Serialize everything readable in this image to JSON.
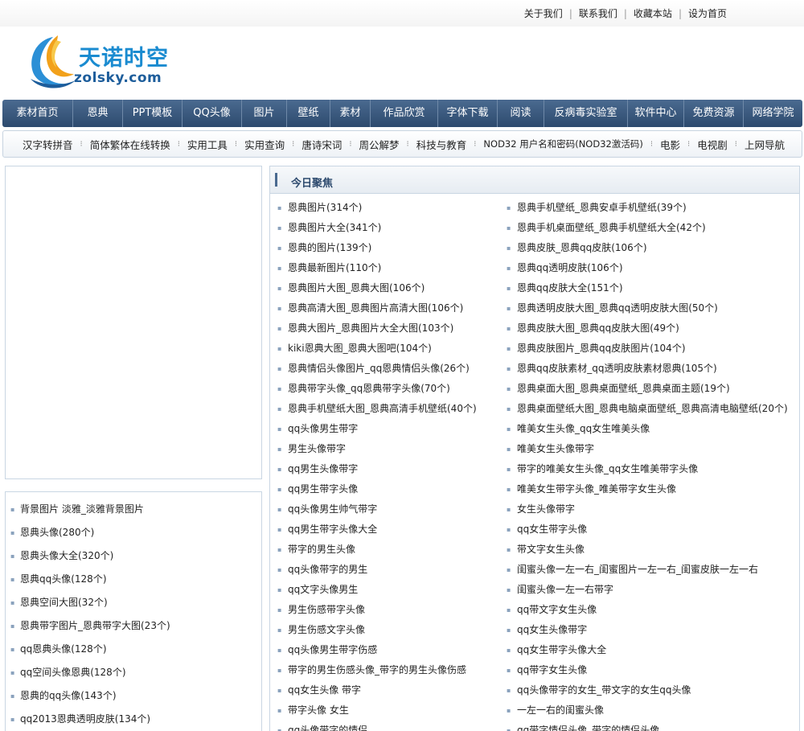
{
  "top_links": [
    "关于我们",
    "联系我们",
    "收藏本站",
    "设为首页"
  ],
  "logo": {
    "cn": "天诺时空",
    "en": "zolsky.com"
  },
  "main_nav": [
    "素材首页",
    "恩典",
    "PPT模板",
    "QQ头像",
    "图片",
    "壁纸",
    "素材",
    "作品欣赏",
    "字体下载",
    "阅读",
    "反病毒实验室",
    "软件中心",
    "免费资源",
    "网络学院"
  ],
  "sub_nav": [
    "汉字转拼音",
    "简体繁体在线转换",
    "实用工具",
    "实用查询",
    "唐诗宋词",
    "周公解梦",
    "科技与教育",
    "NOD32 用户名和密码(NOD32激活码)",
    "电影",
    "电视剧",
    "上网导航"
  ],
  "left_list": [
    "背景图片 淡雅_淡雅背景图片",
    "恩典头像(280个)",
    "恩典头像大全(320个)",
    "恩典qq头像(128个)",
    "恩典空间大图(32个)",
    "恩典带字图片_恩典带字大图(23个)",
    "qq恩典头像(128个)",
    "qq空间头像恩典(128个)",
    "恩典的qq头像(143个)",
    "qq2013恩典透明皮肤(134个)"
  ],
  "focus": {
    "title": "今日聚焦",
    "left": [
      "恩典图片(314个)",
      "恩典图片大全(341个)",
      "恩典的图片(139个)",
      "恩典最新图片(110个)",
      "恩典图片大图_恩典大图(106个)",
      "恩典高清大图_恩典图片高清大图(106个)",
      "恩典大图片_恩典图片大全大图(103个)",
      "kiki恩典大图_恩典大图吧(104个)",
      "恩典情侣头像图片_qq恩典情侣头像(26个)",
      "恩典带字头像_qq恩典带字头像(70个)",
      "恩典手机壁纸大图_恩典高清手机壁纸(40个)",
      "qq头像男生带字",
      "男生头像带字",
      "qq男生头像带字",
      "qq男生带字头像",
      "qq头像男生帅气带字",
      "qq男生带字头像大全",
      "带字的男生头像",
      "qq头像带字的男生",
      "qq文字头像男生",
      "男生伤感带字头像",
      "男生伤感文字头像",
      "qq头像男生带字伤感",
      "带字的男生伤感头像_带字的男生头像伤感",
      "qq女生头像 带字",
      "带字头像 女生",
      "qq头像带字的情侣"
    ],
    "right": [
      "恩典手机壁纸_恩典安卓手机壁纸(39个)",
      "恩典手机桌面壁纸_恩典手机壁纸大全(42个)",
      "恩典皮肤_恩典qq皮肤(106个)",
      "恩典qq透明皮肤(106个)",
      "恩典qq皮肤大全(151个)",
      "恩典透明皮肤大图_恩典qq透明皮肤大图(50个)",
      "恩典皮肤大图_恩典qq皮肤大图(49个)",
      "恩典皮肤图片_恩典qq皮肤图片(104个)",
      "恩典qq皮肤素材_qq透明皮肤素材恩典(105个)",
      "恩典桌面大图_恩典桌面壁纸_恩典桌面主题(19个)",
      "恩典桌面壁纸大图_恩典电脑桌面壁纸_恩典高清电脑壁纸(20个)",
      "唯美女生头像_qq女生唯美头像",
      "唯美女生头像带字",
      "带字的唯美女生头像_qq女生唯美带字头像",
      "唯美女生带字头像_唯美带字女生头像",
      "女生头像带字",
      "qq女生带字头像",
      "带文字女生头像",
      "闺蜜头像一左一右_闺蜜图片一左一右_闺蜜皮肤一左一右",
      "闺蜜头像一左一右带字",
      "qq带文字女生头像",
      "qq女生头像带字",
      "qq女生带字头像大全",
      "qq带字女生头像",
      "qq头像带字的女生_带文字的女生qq头像",
      "一左一右的闺蜜头像",
      "qq带字情侣头像_带字的情侣头像"
    ]
  },
  "colors": {
    "nav_bg": "#2d4a6e",
    "accent": "#1a8bd0",
    "border": "#c9d6e3"
  }
}
